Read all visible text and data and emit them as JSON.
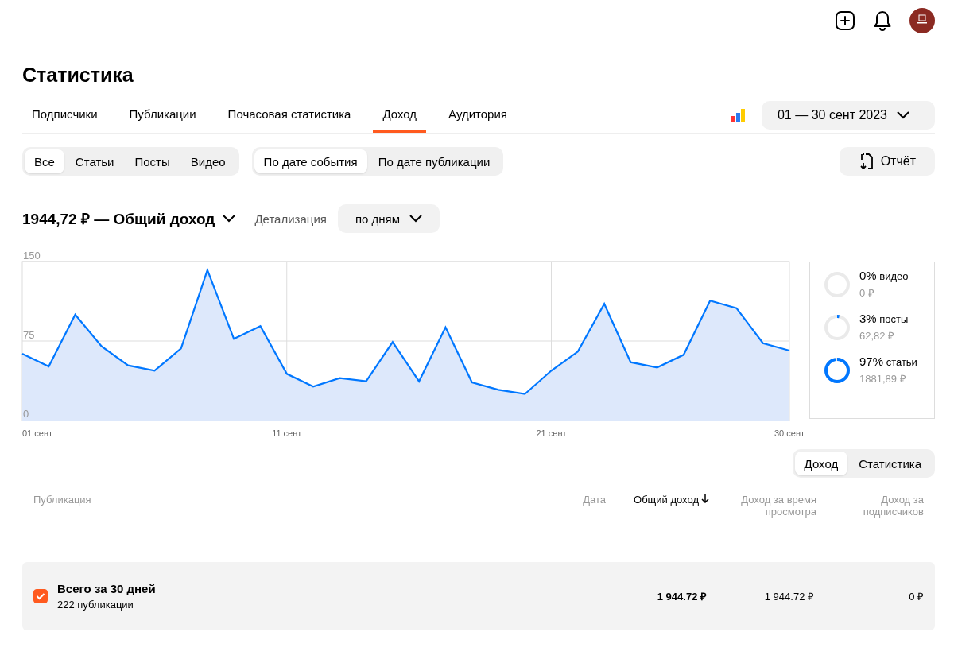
{
  "title": "Статистика",
  "tabs": [
    {
      "label": "Подписчики",
      "selected": false
    },
    {
      "label": "Публикации",
      "selected": false
    },
    {
      "label": "Почасовая статистика",
      "selected": false
    },
    {
      "label": "Доход",
      "selected": true
    },
    {
      "label": "Аудитория",
      "selected": false
    }
  ],
  "date_range": "01 — 30 сент 2023",
  "type_filters": [
    {
      "label": "Все",
      "selected": true
    },
    {
      "label": "Статьи",
      "selected": false
    },
    {
      "label": "Посты",
      "selected": false
    },
    {
      "label": "Видео",
      "selected": false
    }
  ],
  "date_filters": [
    {
      "label": "По дате события",
      "selected": true
    },
    {
      "label": "По дате публикации",
      "selected": false
    }
  ],
  "report_button": "Отчёт",
  "total": "1944,72 ₽ — Общий доход",
  "detail_label": "Детализация",
  "detail_value": "по дням",
  "chart": {
    "chart_data": {
      "type": "area",
      "x": [
        1,
        2,
        3,
        4,
        5,
        6,
        7,
        8,
        9,
        10,
        11,
        12,
        13,
        14,
        15,
        16,
        17,
        18,
        19,
        20,
        21,
        22,
        23,
        24,
        25,
        26,
        27,
        28,
        29,
        30
      ],
      "series": [
        {
          "color": "#0077ff",
          "values": [
            63,
            51,
            100,
            70,
            52,
            47,
            68,
            142,
            77,
            89,
            44,
            32,
            40,
            37,
            74,
            37,
            88,
            36,
            29,
            25,
            47,
            65,
            110,
            55,
            50,
            62,
            113,
            106,
            73,
            66
          ]
        }
      ],
      "grid": true,
      "xlim": [
        1,
        30
      ],
      "ylim": [
        0,
        150
      ],
      "yticks": [
        0,
        75,
        150
      ],
      "xticks": [
        {
          "value": 1,
          "label": "01 сент"
        },
        {
          "value": 11,
          "label": "11 сент"
        },
        {
          "value": 21,
          "label": "21 сент"
        },
        {
          "value": 30,
          "label": "30 сент"
        }
      ]
    }
  },
  "breakdown": [
    {
      "percent": "0%",
      "name": "видео",
      "amount": "0 ₽",
      "level": 0
    },
    {
      "percent": "3%",
      "name": "посты",
      "amount": "62,82 ₽",
      "level": 0.03
    },
    {
      "percent": "97%",
      "name": "статьи",
      "amount": "1881,89 ₽",
      "level": 0.97
    }
  ],
  "view_toggle": [
    {
      "label": "Доход",
      "selected": true
    },
    {
      "label": "Статистика",
      "selected": false
    }
  ],
  "table": {
    "columns": [
      {
        "label": "Публикация",
        "sorted": false
      },
      {
        "label": "Дата",
        "sorted": false
      },
      {
        "label": "Общий доход",
        "sorted": true
      },
      {
        "label": "Доход за время просмотра",
        "sorted": false
      },
      {
        "label": "Доход за подписчиков",
        "sorted": false
      }
    ],
    "total_row": {
      "checked": true,
      "title": "Всего за 30 дней",
      "subtitle": "222 публикации",
      "total": "1 944.72 ₽",
      "view_income": "1 944.72 ₽",
      "subscriber_income": "0 ₽"
    }
  }
}
